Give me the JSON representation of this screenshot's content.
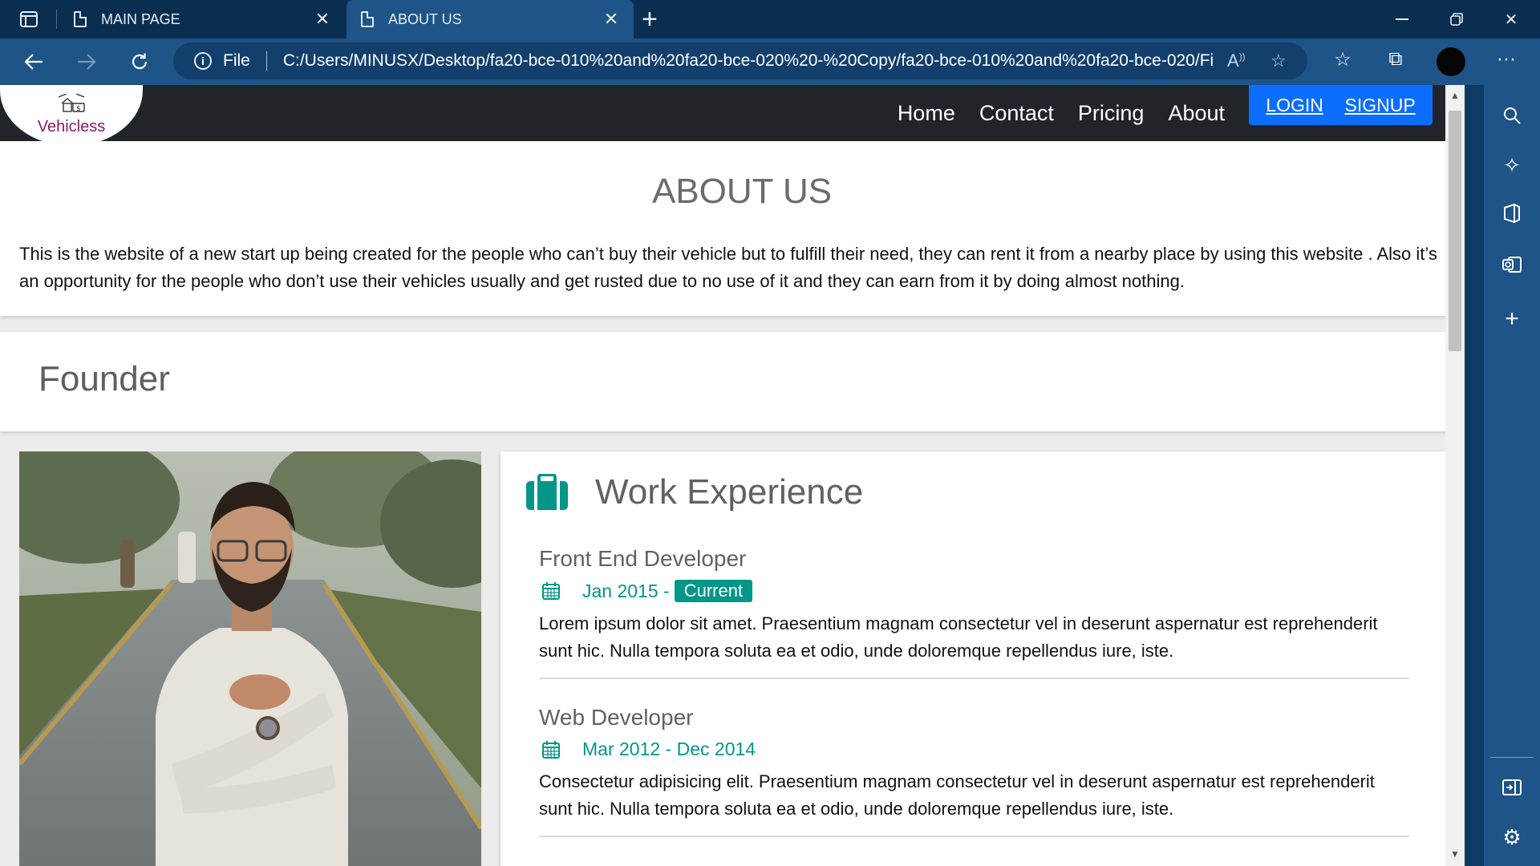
{
  "browser": {
    "tabs": [
      {
        "title": "MAIN PAGE",
        "active": false
      },
      {
        "title": "ABOUT US",
        "active": true
      }
    ],
    "address": {
      "scheme_label": "File",
      "url": "C:/Users/MINUSX/Desktop/fa20-bce-010%20and%20fa20-bce-020%20-%20Copy/fa20-bce-010%20and%20fa20-bce-020/Fi..."
    }
  },
  "site": {
    "logo_text": "Vehicless",
    "nav": [
      "Home",
      "Contact",
      "Pricing",
      "About"
    ],
    "login_label": "LOGIN",
    "signup_label": "SIGNUP"
  },
  "about": {
    "title": "ABOUT US",
    "text": "This is the website of a new start up being created for the people who can’t buy their vehicle but to fulfill their need, they can rent it from a nearby place by using this website . Also it’s an opportunity for the people who don’t use their vehicles usually and get rusted due to no use of it and they can earn from it by doing almost nothing."
  },
  "founder": {
    "title": "Founder"
  },
  "work": {
    "title": "Work Experience",
    "jobs": [
      {
        "title": "Front End Developer",
        "date": "Jan 2015 -",
        "badge": "Current",
        "desc": "Lorem ipsum dolor sit amet. Praesentium magnam consectetur vel in deserunt aspernatur est reprehenderit sunt hic. Nulla tempora soluta ea et odio, unde doloremque repellendus iure, iste."
      },
      {
        "title": "Web Developer",
        "date": "Mar 2012 - Dec 2014",
        "desc": "Consectetur adipisicing elit. Praesentium magnam consectetur vel in deserunt aspernatur est reprehenderit sunt hic. Nulla tempora soluta ea et odio, unde doloremque repellendus iure, iste."
      }
    ]
  },
  "colors": {
    "accent_teal": "#009688",
    "button_blue": "#0d6efd",
    "nav_dark": "#212529",
    "browser_blue": "#1e5487"
  }
}
